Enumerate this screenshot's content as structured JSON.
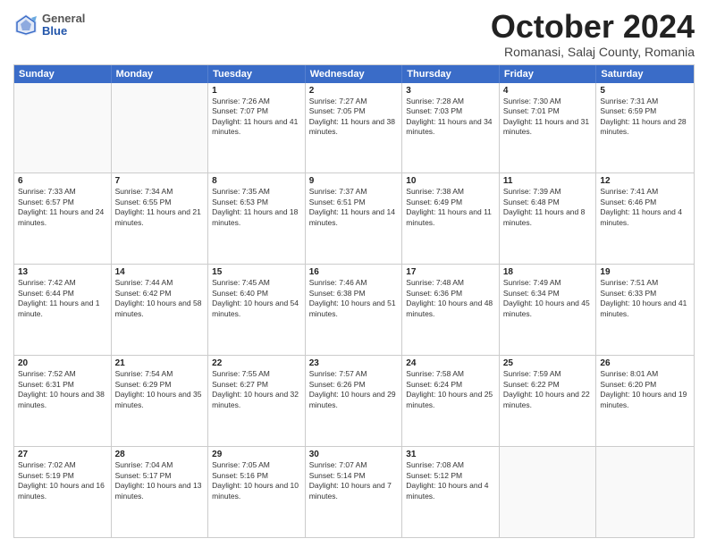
{
  "header": {
    "logo": {
      "general": "General",
      "blue": "Blue"
    },
    "month": "October 2024",
    "location": "Romanasi, Salaj County, Romania"
  },
  "weekdays": [
    "Sunday",
    "Monday",
    "Tuesday",
    "Wednesday",
    "Thursday",
    "Friday",
    "Saturday"
  ],
  "weeks": [
    [
      {
        "day": "",
        "empty": true
      },
      {
        "day": "",
        "empty": true
      },
      {
        "day": "1",
        "sunrise": "Sunrise: 7:26 AM",
        "sunset": "Sunset: 7:07 PM",
        "daylight": "Daylight: 11 hours and 41 minutes."
      },
      {
        "day": "2",
        "sunrise": "Sunrise: 7:27 AM",
        "sunset": "Sunset: 7:05 PM",
        "daylight": "Daylight: 11 hours and 38 minutes."
      },
      {
        "day": "3",
        "sunrise": "Sunrise: 7:28 AM",
        "sunset": "Sunset: 7:03 PM",
        "daylight": "Daylight: 11 hours and 34 minutes."
      },
      {
        "day": "4",
        "sunrise": "Sunrise: 7:30 AM",
        "sunset": "Sunset: 7:01 PM",
        "daylight": "Daylight: 11 hours and 31 minutes."
      },
      {
        "day": "5",
        "sunrise": "Sunrise: 7:31 AM",
        "sunset": "Sunset: 6:59 PM",
        "daylight": "Daylight: 11 hours and 28 minutes."
      }
    ],
    [
      {
        "day": "6",
        "sunrise": "Sunrise: 7:33 AM",
        "sunset": "Sunset: 6:57 PM",
        "daylight": "Daylight: 11 hours and 24 minutes."
      },
      {
        "day": "7",
        "sunrise": "Sunrise: 7:34 AM",
        "sunset": "Sunset: 6:55 PM",
        "daylight": "Daylight: 11 hours and 21 minutes."
      },
      {
        "day": "8",
        "sunrise": "Sunrise: 7:35 AM",
        "sunset": "Sunset: 6:53 PM",
        "daylight": "Daylight: 11 hours and 18 minutes."
      },
      {
        "day": "9",
        "sunrise": "Sunrise: 7:37 AM",
        "sunset": "Sunset: 6:51 PM",
        "daylight": "Daylight: 11 hours and 14 minutes."
      },
      {
        "day": "10",
        "sunrise": "Sunrise: 7:38 AM",
        "sunset": "Sunset: 6:49 PM",
        "daylight": "Daylight: 11 hours and 11 minutes."
      },
      {
        "day": "11",
        "sunrise": "Sunrise: 7:39 AM",
        "sunset": "Sunset: 6:48 PM",
        "daylight": "Daylight: 11 hours and 8 minutes."
      },
      {
        "day": "12",
        "sunrise": "Sunrise: 7:41 AM",
        "sunset": "Sunset: 6:46 PM",
        "daylight": "Daylight: 11 hours and 4 minutes."
      }
    ],
    [
      {
        "day": "13",
        "sunrise": "Sunrise: 7:42 AM",
        "sunset": "Sunset: 6:44 PM",
        "daylight": "Daylight: 11 hours and 1 minute."
      },
      {
        "day": "14",
        "sunrise": "Sunrise: 7:44 AM",
        "sunset": "Sunset: 6:42 PM",
        "daylight": "Daylight: 10 hours and 58 minutes."
      },
      {
        "day": "15",
        "sunrise": "Sunrise: 7:45 AM",
        "sunset": "Sunset: 6:40 PM",
        "daylight": "Daylight: 10 hours and 54 minutes."
      },
      {
        "day": "16",
        "sunrise": "Sunrise: 7:46 AM",
        "sunset": "Sunset: 6:38 PM",
        "daylight": "Daylight: 10 hours and 51 minutes."
      },
      {
        "day": "17",
        "sunrise": "Sunrise: 7:48 AM",
        "sunset": "Sunset: 6:36 PM",
        "daylight": "Daylight: 10 hours and 48 minutes."
      },
      {
        "day": "18",
        "sunrise": "Sunrise: 7:49 AM",
        "sunset": "Sunset: 6:34 PM",
        "daylight": "Daylight: 10 hours and 45 minutes."
      },
      {
        "day": "19",
        "sunrise": "Sunrise: 7:51 AM",
        "sunset": "Sunset: 6:33 PM",
        "daylight": "Daylight: 10 hours and 41 minutes."
      }
    ],
    [
      {
        "day": "20",
        "sunrise": "Sunrise: 7:52 AM",
        "sunset": "Sunset: 6:31 PM",
        "daylight": "Daylight: 10 hours and 38 minutes."
      },
      {
        "day": "21",
        "sunrise": "Sunrise: 7:54 AM",
        "sunset": "Sunset: 6:29 PM",
        "daylight": "Daylight: 10 hours and 35 minutes."
      },
      {
        "day": "22",
        "sunrise": "Sunrise: 7:55 AM",
        "sunset": "Sunset: 6:27 PM",
        "daylight": "Daylight: 10 hours and 32 minutes."
      },
      {
        "day": "23",
        "sunrise": "Sunrise: 7:57 AM",
        "sunset": "Sunset: 6:26 PM",
        "daylight": "Daylight: 10 hours and 29 minutes."
      },
      {
        "day": "24",
        "sunrise": "Sunrise: 7:58 AM",
        "sunset": "Sunset: 6:24 PM",
        "daylight": "Daylight: 10 hours and 25 minutes."
      },
      {
        "day": "25",
        "sunrise": "Sunrise: 7:59 AM",
        "sunset": "Sunset: 6:22 PM",
        "daylight": "Daylight: 10 hours and 22 minutes."
      },
      {
        "day": "26",
        "sunrise": "Sunrise: 8:01 AM",
        "sunset": "Sunset: 6:20 PM",
        "daylight": "Daylight: 10 hours and 19 minutes."
      }
    ],
    [
      {
        "day": "27",
        "sunrise": "Sunrise: 7:02 AM",
        "sunset": "Sunset: 5:19 PM",
        "daylight": "Daylight: 10 hours and 16 minutes."
      },
      {
        "day": "28",
        "sunrise": "Sunrise: 7:04 AM",
        "sunset": "Sunset: 5:17 PM",
        "daylight": "Daylight: 10 hours and 13 minutes."
      },
      {
        "day": "29",
        "sunrise": "Sunrise: 7:05 AM",
        "sunset": "Sunset: 5:16 PM",
        "daylight": "Daylight: 10 hours and 10 minutes."
      },
      {
        "day": "30",
        "sunrise": "Sunrise: 7:07 AM",
        "sunset": "Sunset: 5:14 PM",
        "daylight": "Daylight: 10 hours and 7 minutes."
      },
      {
        "day": "31",
        "sunrise": "Sunrise: 7:08 AM",
        "sunset": "Sunset: 5:12 PM",
        "daylight": "Daylight: 10 hours and 4 minutes."
      },
      {
        "day": "",
        "empty": true
      },
      {
        "day": "",
        "empty": true
      }
    ]
  ]
}
